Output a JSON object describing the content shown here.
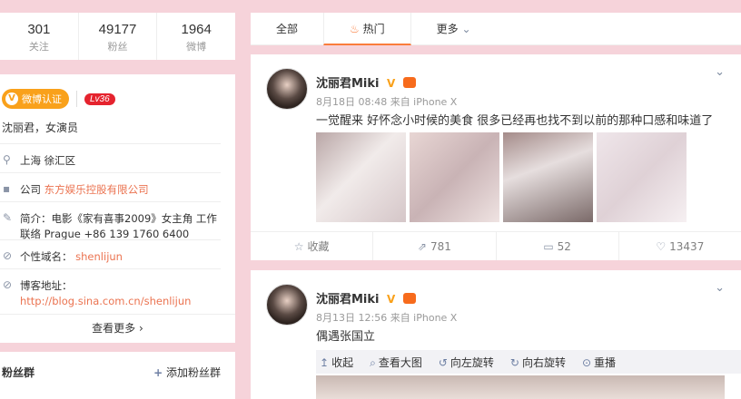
{
  "stats": [
    {
      "num": "301",
      "label": "关注"
    },
    {
      "num": "49177",
      "label": "粉丝"
    },
    {
      "num": "1964",
      "label": "微博"
    }
  ],
  "profile": {
    "verify_badge": "微博认证",
    "level": "Lv36",
    "bio": "沈丽君，女演员",
    "location": "上海 徐汇区",
    "company_prefix": "公司",
    "company": "东方娱乐控股有限公司",
    "intro": "简介：电影《家有喜事2009》女主角 工作联络 Prague +86 139 1760 6400",
    "domain_label": "个性域名：",
    "domain": "shenlijun",
    "blog_label": "博客地址：",
    "blog": "http://blog.sina.com.cn/shenlijun",
    "see_more": "查看更多"
  },
  "fans": {
    "title": "粉丝群",
    "add": "添加粉丝群"
  },
  "tabs": [
    {
      "label": "全部"
    },
    {
      "label": "热门"
    },
    {
      "label": "更多"
    }
  ],
  "posts": [
    {
      "user": "沈丽君Miki",
      "meta": "8月18日 08:48 来自 iPhone X",
      "text": "一觉醒来 好怀念小时候的美食 很多已经再也找不到以前的那种口感和味道了",
      "actions": {
        "fav": "收藏",
        "repost": "781",
        "comment": "52",
        "like": "13437"
      }
    },
    {
      "user": "沈丽君Miki",
      "meta": "8月13日 12:56 来自 iPhone X",
      "text": "偶遇张国立",
      "media": {
        "collapse": "收起",
        "view_large": "查看大图",
        "rotate_left": "向左旋转",
        "rotate_right": "向右旋转",
        "replay": "重播"
      }
    }
  ],
  "colors": {
    "accent": "#fa7d3c",
    "verify": "#f9a11b",
    "link": "#eb7350",
    "background": "#f6d3da"
  }
}
